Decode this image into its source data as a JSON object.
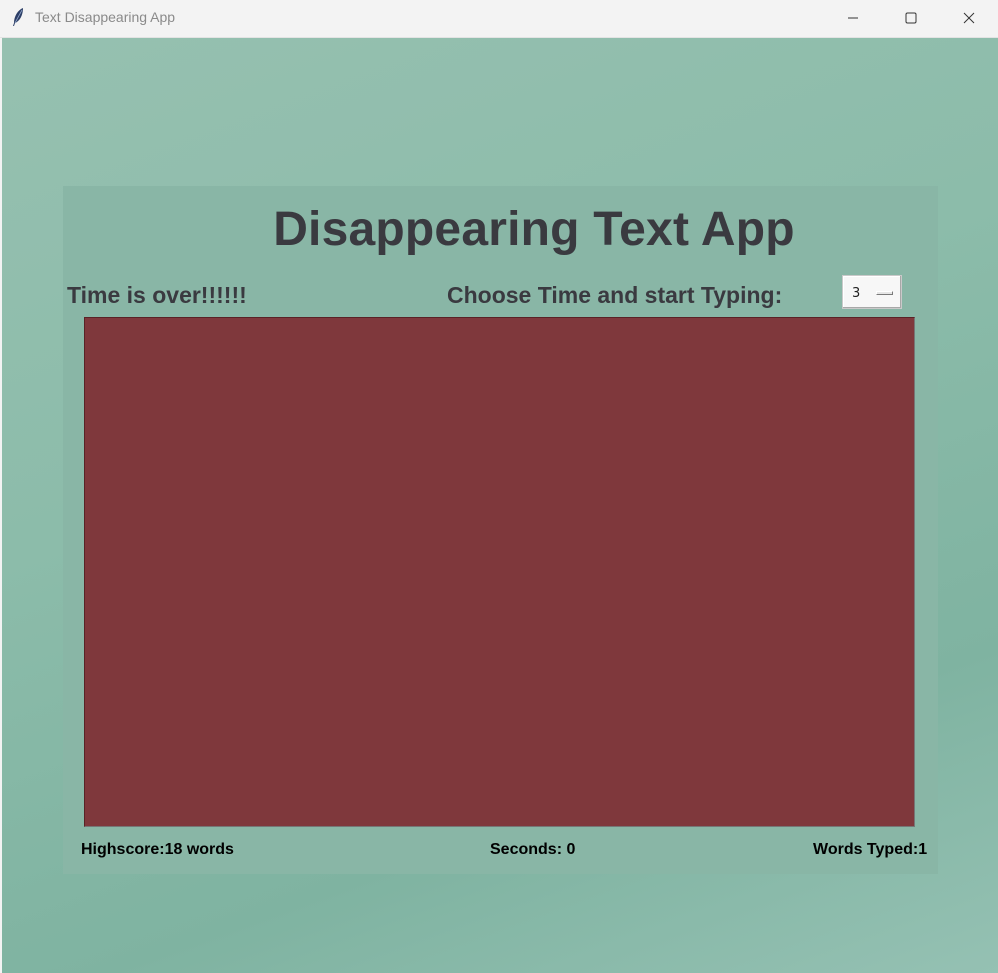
{
  "window": {
    "title": "Text Disappearing App",
    "app_icon": "feather-icon",
    "controls": [
      "minimize-icon",
      "maximize-icon",
      "close-icon"
    ]
  },
  "app": {
    "heading": "Disappearing Text App",
    "status_message": "Time is over!!!!!!",
    "choose_label": "Choose Time and start Typing:",
    "time_select": {
      "selected": "3"
    },
    "text_area": {
      "value": ""
    },
    "footer": {
      "highscore": "Highscore:18 words",
      "seconds": "Seconds: 0",
      "words_typed": "Words Typed:1"
    }
  },
  "colors": {
    "background": "#8cbcaa",
    "frame": "#89b6a6",
    "text_area": "#7f383c",
    "heading_text": "#3a3a40"
  }
}
